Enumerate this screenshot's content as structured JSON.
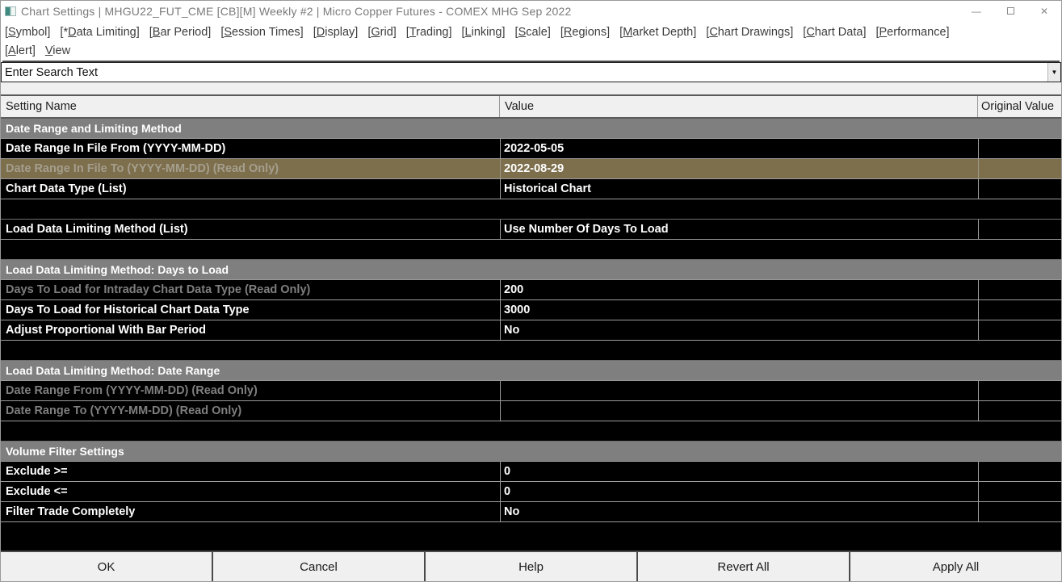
{
  "window": {
    "title": "Chart Settings | MHGU22_FUT_CME [CB][M]  Weekly  #2 | Micro Copper Futures - COMEX MHG Sep 2022",
    "controls": [
      {
        "id": "minimize",
        "glyph": "—"
      },
      {
        "id": "maximize",
        "glyph": ""
      },
      {
        "id": "close",
        "glyph": "✕"
      }
    ]
  },
  "menu": {
    "rows": [
      [
        {
          "label": "[Symbol]",
          "mnemonic": "S"
        },
        {
          "label": "[*Data Limiting]",
          "mnemonic": "D"
        },
        {
          "label": "[Bar Period]",
          "mnemonic": "B"
        },
        {
          "label": "[Session Times]",
          "mnemonic": "S"
        },
        {
          "label": "[Display]",
          "mnemonic": "D"
        },
        {
          "label": "[Grid]",
          "mnemonic": "G"
        },
        {
          "label": "[Trading]",
          "mnemonic": "T"
        },
        {
          "label": "[Linking]",
          "mnemonic": "L"
        },
        {
          "label": "[Scale]",
          "mnemonic": "S"
        },
        {
          "label": "[Regions]",
          "mnemonic": "R"
        },
        {
          "label": "[Market Depth]",
          "mnemonic": "M"
        },
        {
          "label": "[Chart Drawings]",
          "mnemonic": "C"
        },
        {
          "label": "[Chart Data]",
          "mnemonic": "C"
        },
        {
          "label": "[Performance]",
          "mnemonic": "P"
        }
      ],
      [
        {
          "label": "[Alert]",
          "mnemonic": "A"
        },
        {
          "label": "View",
          "mnemonic": "V"
        }
      ]
    ]
  },
  "search": {
    "value": "Enter Search Text",
    "dropdown_icon": "▼"
  },
  "table": {
    "columns": [
      "Setting Name",
      "Value",
      "Original Value"
    ],
    "rows": [
      {
        "type": "section",
        "label": "Date Range and Limiting Method"
      },
      {
        "type": "data",
        "label": "Date Range In File From (YYYY-MM-DD)",
        "value": "2022-05-05",
        "original": ""
      },
      {
        "type": "data",
        "label": "Date Range In File To (YYYY-MM-DD) (Read Only)",
        "value": "2022-08-29",
        "original": "",
        "readonly": true,
        "selected": true
      },
      {
        "type": "data",
        "label": "Chart Data Type (List)",
        "value": "Historical Chart",
        "original": ""
      },
      {
        "type": "empty"
      },
      {
        "type": "data",
        "label": "Load Data Limiting Method (List)",
        "value": "Use Number Of Days To Load",
        "original": ""
      },
      {
        "type": "empty"
      },
      {
        "type": "section",
        "label": "Load Data Limiting Method: Days to Load"
      },
      {
        "type": "data",
        "label": "Days To Load for Intraday Chart Data Type (Read Only)",
        "value": "200",
        "original": "",
        "readonly": true
      },
      {
        "type": "data",
        "label": "Days To Load for Historical Chart Data Type",
        "value": "3000",
        "original": ""
      },
      {
        "type": "data",
        "label": "Adjust Proportional With Bar Period",
        "value": "No",
        "original": ""
      },
      {
        "type": "empty"
      },
      {
        "type": "section",
        "label": "Load Data Limiting Method: Date Range"
      },
      {
        "type": "data",
        "label": "Date Range From (YYYY-MM-DD) (Read Only)",
        "value": "",
        "original": "",
        "readonly": true
      },
      {
        "type": "data",
        "label": "Date Range To (YYYY-MM-DD) (Read Only)",
        "value": "",
        "original": "",
        "readonly": true
      },
      {
        "type": "empty"
      },
      {
        "type": "section",
        "label": "Volume Filter Settings"
      },
      {
        "type": "data",
        "label": "Exclude >=",
        "value": "0",
        "original": ""
      },
      {
        "type": "data",
        "label": "Exclude <=",
        "value": "0",
        "original": ""
      },
      {
        "type": "data",
        "label": "Filter Trade Completely",
        "value": "No",
        "original": ""
      }
    ]
  },
  "buttons": [
    "OK",
    "Cancel",
    "Help",
    "Revert All",
    "Apply All"
  ],
  "colors": {
    "selected_row": "#7d6e4c",
    "section_header": "#7f7f7f",
    "row_background": "#000000",
    "readonly_text": "#7f7f7f",
    "row_text": "#ffffff"
  }
}
